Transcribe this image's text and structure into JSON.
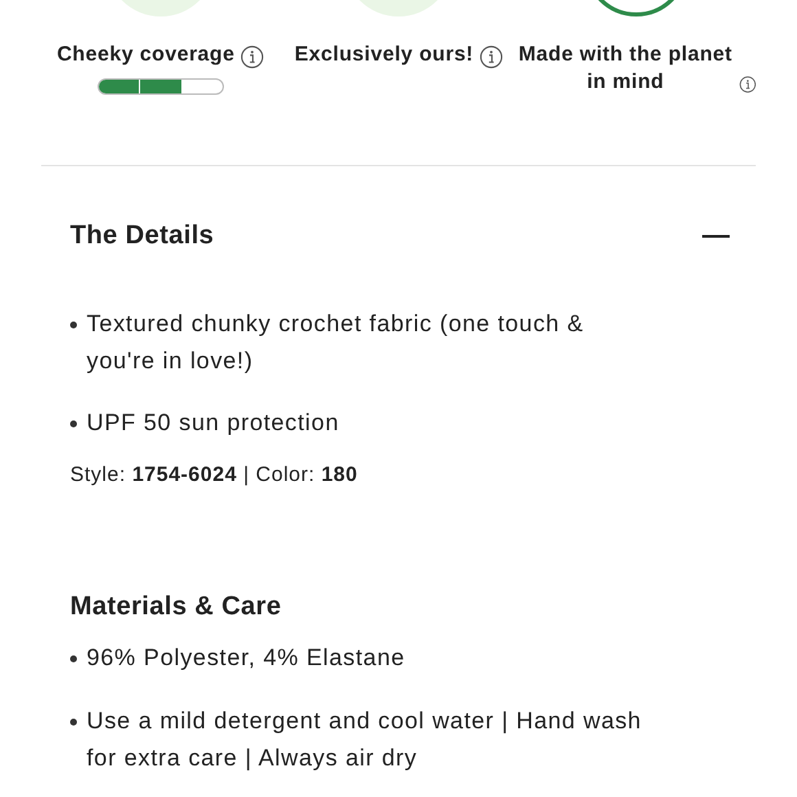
{
  "features": [
    {
      "kind": "filled",
      "label": "Cheeky coverage",
      "meter": {
        "level": 0.67
      }
    },
    {
      "kind": "filled",
      "label": "Exclusively ours!"
    },
    {
      "kind": "outline",
      "label": "Made with the planet in mind"
    }
  ],
  "details": {
    "title": "The Details",
    "expanded": true,
    "bullets": [
      "Textured chunky crochet fabric (one touch & you're in love!)",
      "UPF 50 sun protection"
    ],
    "style_line": "Style: **1754-6024** | Color: **180**"
  },
  "materials_care": {
    "title": "Materials & Care",
    "bullets": [
      "96% Polyester, 4% Elastane",
      "Use a mild detergent and cool water | Hand wash for extra care | Always air dry"
    ]
  }
}
